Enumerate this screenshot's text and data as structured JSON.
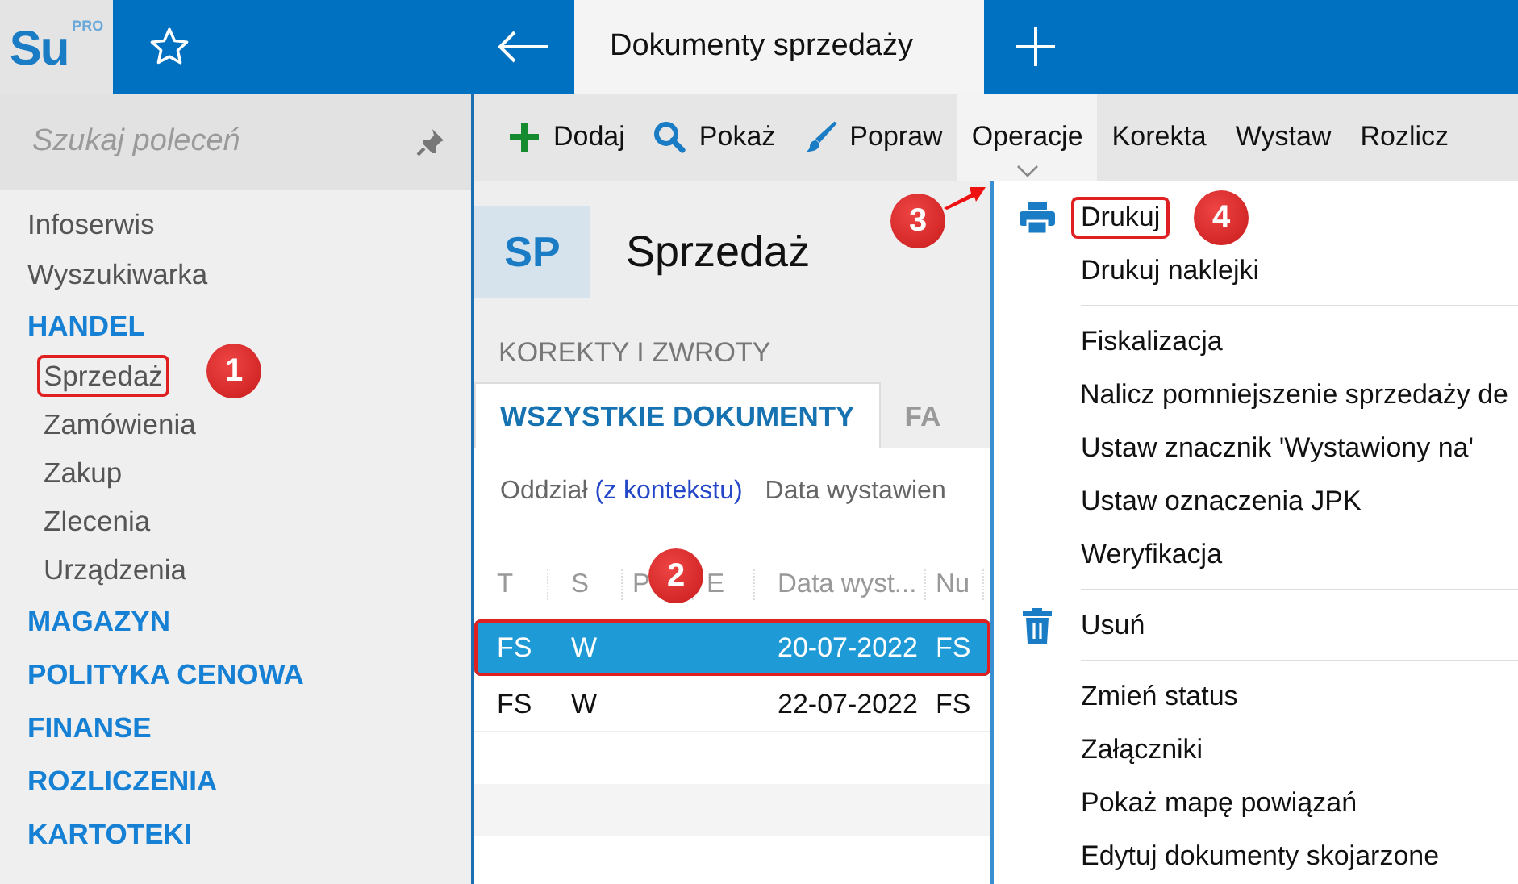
{
  "app": {
    "logo_text": "Su",
    "logo_badge": "PRO"
  },
  "top_bar": {
    "active_tab": "Dokumenty sprzedaży"
  },
  "sidebar": {
    "search": {
      "placeholder": "Szukaj poleceń"
    },
    "items": [
      {
        "label": "Infoserwis",
        "kind": "link"
      },
      {
        "label": "Wyszukiwarka",
        "kind": "link"
      },
      {
        "label": "HANDEL",
        "kind": "section",
        "children": [
          {
            "label": "Sprzedaż",
            "highlighted": true
          },
          {
            "label": "Zamówienia",
            "highlighted": false
          },
          {
            "label": "Zakup",
            "highlighted": false
          },
          {
            "label": "Zlecenia",
            "highlighted": false
          },
          {
            "label": "Urządzenia",
            "highlighted": false
          }
        ]
      },
      {
        "label": "MAGAZYN",
        "kind": "section"
      },
      {
        "label": "POLITYKA CENOWA",
        "kind": "section"
      },
      {
        "label": "FINANSE",
        "kind": "section"
      },
      {
        "label": "ROZLICZENIA",
        "kind": "section"
      },
      {
        "label": "KARTOTEKI",
        "kind": "section"
      }
    ]
  },
  "toolbar": [
    {
      "label": "Dodaj",
      "selected": false
    },
    {
      "label": "Pokaż",
      "selected": false
    },
    {
      "label": "Popraw",
      "selected": false
    },
    {
      "label": "Operacje",
      "selected": true
    },
    {
      "label": "Korekta",
      "selected": false
    },
    {
      "label": "Wystaw",
      "selected": false
    },
    {
      "label": "Rozlicz",
      "selected": false
    }
  ],
  "module": {
    "badge": "SP",
    "title": "Sprzedaż",
    "group": "KOREKTY I ZWROTY"
  },
  "tabs": [
    {
      "label": "WSZYSTKIE DOKUMENTY",
      "selected": true
    },
    {
      "label": "FA",
      "selected": false
    }
  ],
  "filter": {
    "label": "Oddział",
    "link": "(z kontekstu)",
    "next": "Data wystawien"
  },
  "table": {
    "columns": [
      "T",
      "S",
      "P",
      "E",
      "Data wyst...",
      "Nu"
    ],
    "rows": [
      {
        "type": "FS",
        "status": "W",
        "date": "20-07-2022",
        "number": "FS",
        "selected": true,
        "highlighted": true
      },
      {
        "type": "FS",
        "status": "W",
        "date": "22-07-2022",
        "number": "FS",
        "selected": false,
        "highlighted": false
      }
    ]
  },
  "menu": [
    {
      "kind": "item",
      "label": "Drukuj",
      "highlighted": true
    },
    {
      "kind": "item",
      "label": "Drukuj naklejki",
      "highlighted": false
    },
    {
      "kind": "separator"
    },
    {
      "kind": "item",
      "label": "Fiskalizacja",
      "highlighted": false
    },
    {
      "kind": "item",
      "label": "Nalicz pomniejszenie sprzedaży de",
      "highlighted": false
    },
    {
      "kind": "item",
      "label": "Ustaw znacznik 'Wystawiony na'",
      "highlighted": false
    },
    {
      "kind": "item",
      "label": "Ustaw oznaczenia JPK",
      "highlighted": false
    },
    {
      "kind": "item",
      "label": "Weryfikacja",
      "highlighted": false
    },
    {
      "kind": "separator"
    },
    {
      "kind": "item",
      "label": "Usuń",
      "highlighted": false
    },
    {
      "kind": "separator"
    },
    {
      "kind": "item",
      "label": "Zmień status",
      "highlighted": false
    },
    {
      "kind": "item",
      "label": "Załączniki",
      "highlighted": false
    },
    {
      "kind": "item",
      "label": "Pokaż mapę powiązań",
      "highlighted": false
    },
    {
      "kind": "item",
      "label": "Edytuj dokumenty skojarzone",
      "highlighted": false
    }
  ],
  "callouts": [
    {
      "number": "1"
    },
    {
      "number": "2"
    },
    {
      "number": "3"
    },
    {
      "number": "4"
    }
  ]
}
